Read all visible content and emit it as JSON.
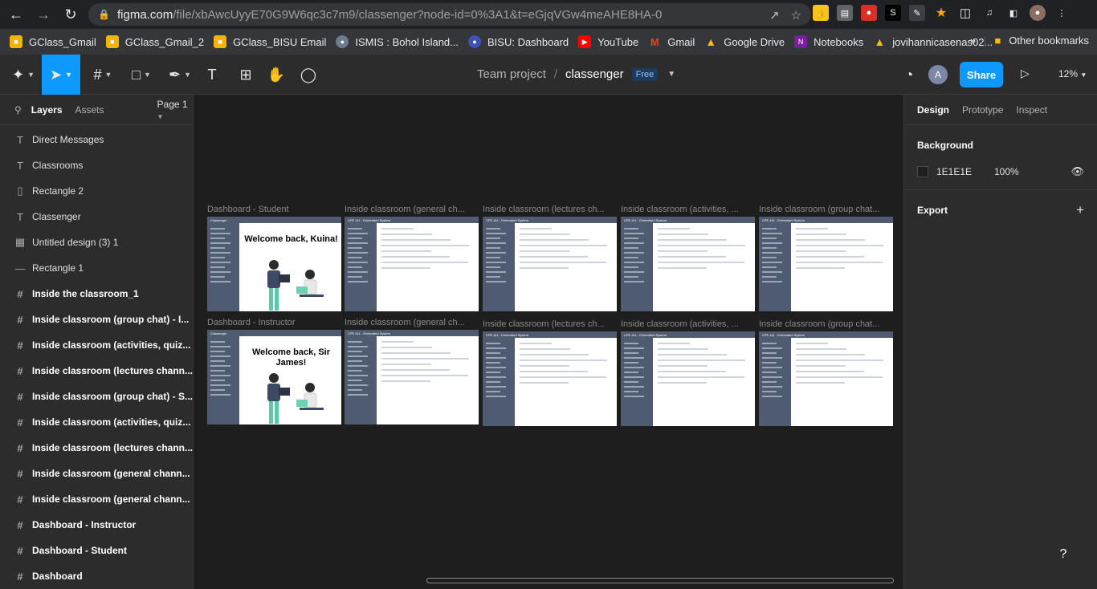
{
  "browser": {
    "url_host": "figma.com",
    "url_path": "/file/xbAwcUyyE70G9W6qc3c7m9/classenger?node-id=0%3A1&t=eGjqVGw4meAHE8HA-0",
    "bookmarks": [
      "GClass_Gmail",
      "GClass_Gmail_2",
      "GClass_BISU Email",
      "ISMIS : Bohol Island...",
      "BISU: Dashboard",
      "YouTube",
      "Gmail",
      "Google Drive",
      "Notebooks",
      "jovihannicasenas02..."
    ],
    "other_bookmarks": "Other bookmarks"
  },
  "toolbar": {
    "team": "Team project",
    "file": "classenger",
    "plan": "Free",
    "avatar": "A",
    "share": "Share",
    "zoom": "12%"
  },
  "left_panel": {
    "tabs": [
      "Layers",
      "Assets"
    ],
    "page": "Page 1",
    "layers": [
      {
        "icon": "text-icon",
        "label": "Direct Messages"
      },
      {
        "icon": "text-icon",
        "label": "Classrooms"
      },
      {
        "icon": "rectangle-icon",
        "label": "Rectangle 2"
      },
      {
        "icon": "text-icon",
        "label": "Classenger"
      },
      {
        "icon": "image-icon",
        "label": "Untitled design (3) 1"
      },
      {
        "icon": "line-icon",
        "label": "Rectangle 1"
      },
      {
        "icon": "frame-icon",
        "label": "Inside the classroom_1"
      },
      {
        "icon": "frame-icon",
        "label": "Inside classroom (group chat) - I..."
      },
      {
        "icon": "frame-icon",
        "label": "Inside classroom (activities, quiz..."
      },
      {
        "icon": "frame-icon",
        "label": "Inside classroom (lectures chann..."
      },
      {
        "icon": "frame-icon",
        "label": "Inside classroom (group chat) - S..."
      },
      {
        "icon": "frame-icon",
        "label": "Inside classroom (activities, quiz..."
      },
      {
        "icon": "frame-icon",
        "label": "Inside classroom (lectures chann..."
      },
      {
        "icon": "frame-icon",
        "label": "Inside classroom (general chann..."
      },
      {
        "icon": "frame-icon",
        "label": "Inside classroom (general chann..."
      },
      {
        "icon": "frame-icon",
        "label": "Dashboard - Instructor"
      },
      {
        "icon": "frame-icon",
        "label": "Dashboard - Student"
      },
      {
        "icon": "frame-icon",
        "label": "Dashboard"
      }
    ]
  },
  "canvas": {
    "row1_labels": [
      "Dashboard - Student",
      "Inside classroom (general ch...",
      "Inside classroom (lectures ch...",
      "Inside classroom (activities, ...",
      "Inside classroom (group chat..."
    ],
    "row2_labels": [
      "Dashboard - Instructor",
      "Inside classroom (general ch...",
      "Inside classroom (lectures ch...",
      "Inside classroom (activities, ...",
      "Inside classroom (group chat..."
    ],
    "app_title": "Classenger",
    "class_title": "CPE 411 - Embedded System",
    "welcome_student": "Welcome back, Kuina!",
    "welcome_instructor": "Welcome back, Sir James!"
  },
  "right_panel": {
    "tabs": [
      "Design",
      "Prototype",
      "Inspect"
    ],
    "background_title": "Background",
    "bg_hex": "1E1E1E",
    "bg_opacity": "100%",
    "export_title": "Export"
  },
  "help": "?"
}
